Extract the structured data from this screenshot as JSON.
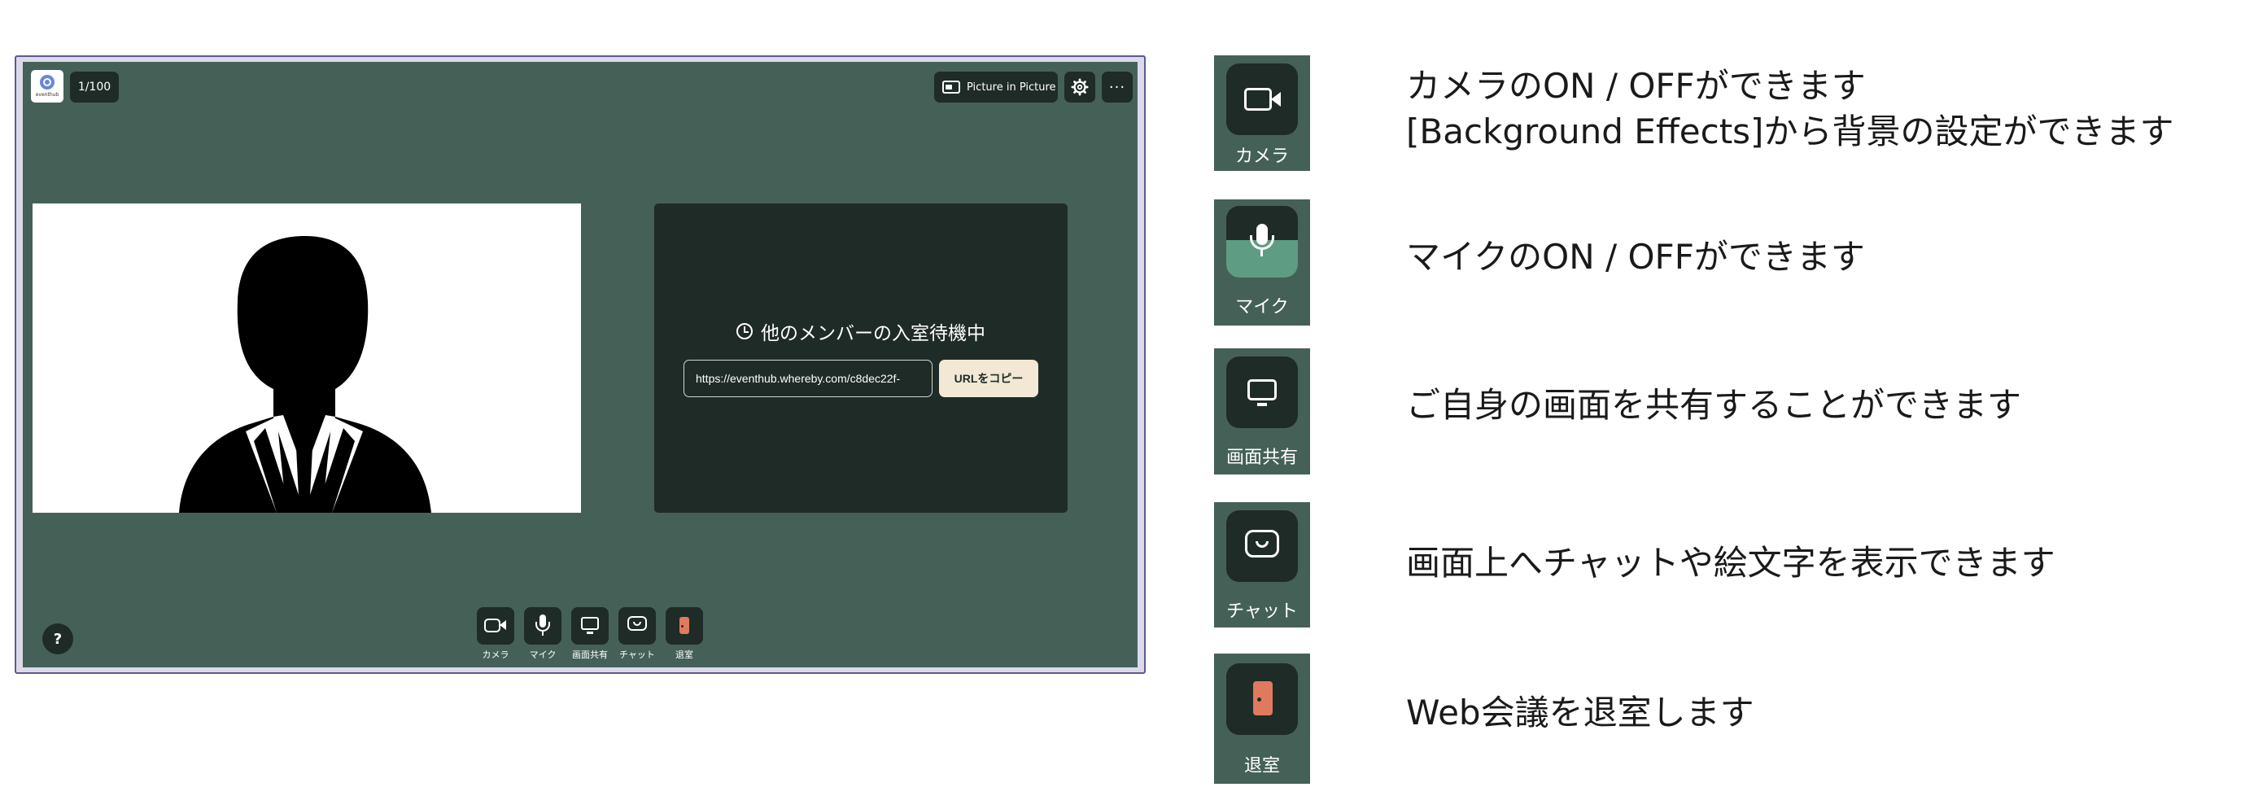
{
  "room": {
    "logo_text": "eventhub",
    "participant_count": "1/100",
    "pip_label": "Picture in Picture",
    "settings_icon": "gear-icon",
    "more_label": "···",
    "help_label": "?"
  },
  "waiting": {
    "title": "他のメンバーの入室待機中",
    "url_value": "https://eventhub.whereby.com/c8dec22f-",
    "copy_label": "URLをコピー"
  },
  "toolbar": [
    {
      "label": "カメラ",
      "icon": "camera-icon"
    },
    {
      "label": "マイク",
      "icon": "microphone-icon"
    },
    {
      "label": "画面共有",
      "icon": "monitor-icon"
    },
    {
      "label": "チャット",
      "icon": "chat-icon"
    },
    {
      "label": "退室",
      "icon": "door-icon"
    }
  ],
  "legend": [
    {
      "label": "カメラ",
      "icon": "camera-icon",
      "lines": [
        "カメラのON / OFFができます",
        "[Background Effects]から背景の設定ができます"
      ]
    },
    {
      "label": "マイク",
      "icon": "microphone-icon",
      "lines": [
        "マイクのON / OFFができます"
      ]
    },
    {
      "label": "画面共有",
      "icon": "monitor-icon",
      "lines": [
        "ご自身の画面を共有することができます"
      ]
    },
    {
      "label": "チャット",
      "icon": "chat-icon",
      "lines": [
        "画面上へチャットや絵文字を表示できます"
      ]
    },
    {
      "label": "退室",
      "icon": "door-icon",
      "lines": [
        "Web会議を退室します"
      ]
    }
  ],
  "colors": {
    "room_bg": "#456157",
    "dark": "#1f2b26",
    "mic_highlight": "#5e9c83",
    "door_accent": "#e07a5f",
    "copy_button": "#f3e8d6"
  }
}
